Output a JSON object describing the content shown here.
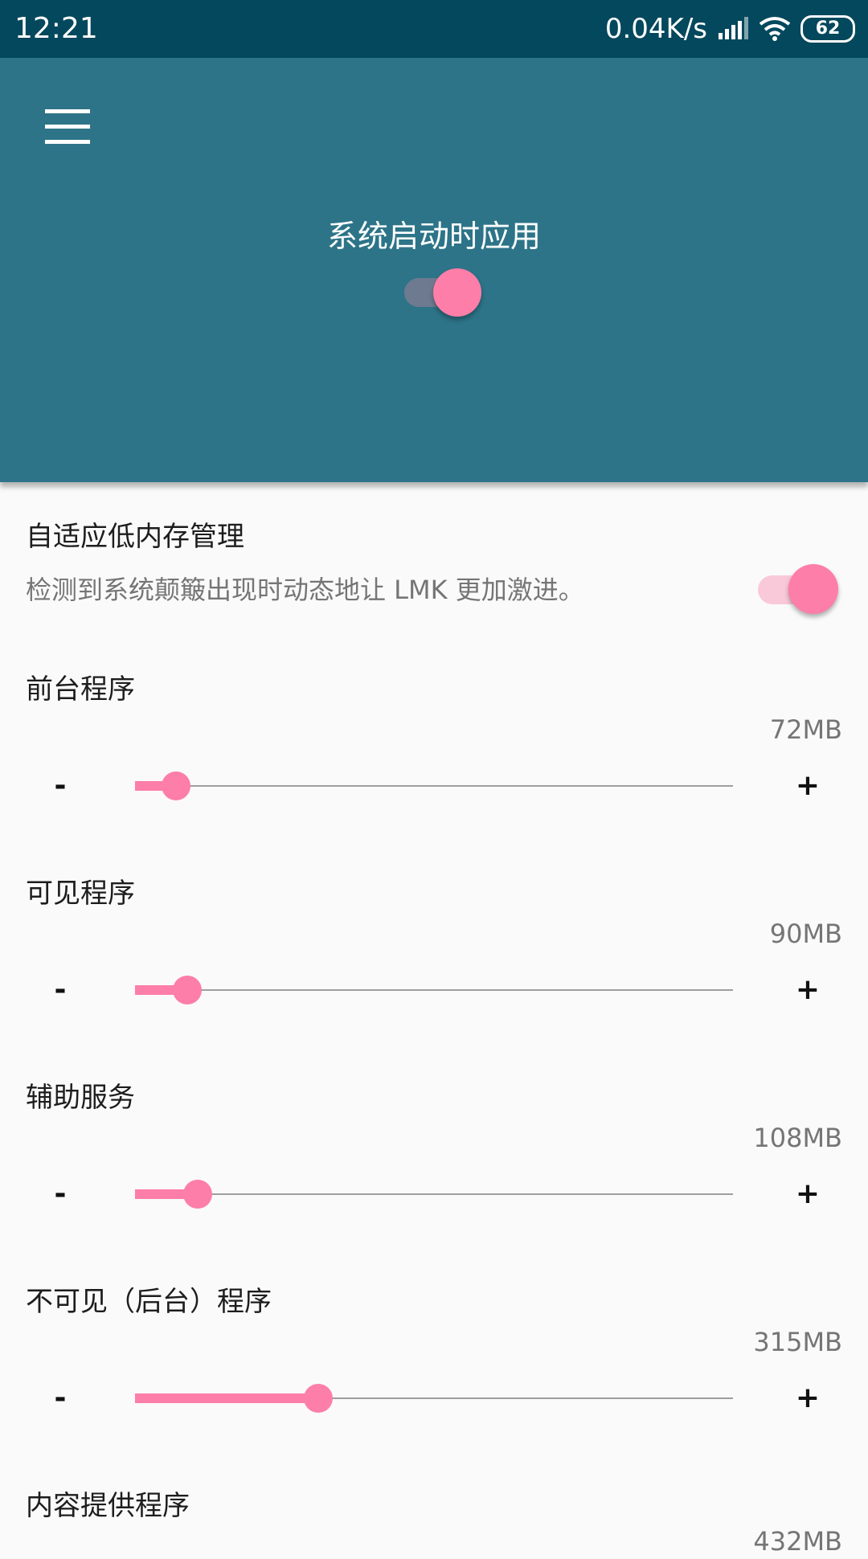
{
  "status_bar": {
    "time": "12:21",
    "network_speed": "0.04K/s",
    "battery": "62"
  },
  "header": {
    "title": "系统启动时应用",
    "apply_on_boot": true
  },
  "adaptive_lmk": {
    "title": "自适应低内存管理",
    "description": "检测到系统颠簸出现时动态地让 LMK 更加激进。",
    "enabled": true
  },
  "sliders": [
    {
      "label": "前台程序",
      "value": "72MB",
      "fraction": 0.069
    },
    {
      "label": "可见程序",
      "value": "90MB",
      "fraction": 0.087
    },
    {
      "label": "辅助服务",
      "value": "108MB",
      "fraction": 0.105
    },
    {
      "label": "不可见（后台）程序",
      "value": "315MB",
      "fraction": 0.307
    },
    {
      "label": "内容提供程序",
      "value": "432MB"
    }
  ],
  "controls": {
    "minus": "-",
    "plus": "+"
  },
  "icons": {
    "menu": "menu-icon",
    "signal": "signal-icon",
    "wifi": "wifi-icon",
    "battery": "battery-icon"
  },
  "colors": {
    "status_bar": "#04485d",
    "header": "#2d7488",
    "accent": "#fd7ea8"
  }
}
